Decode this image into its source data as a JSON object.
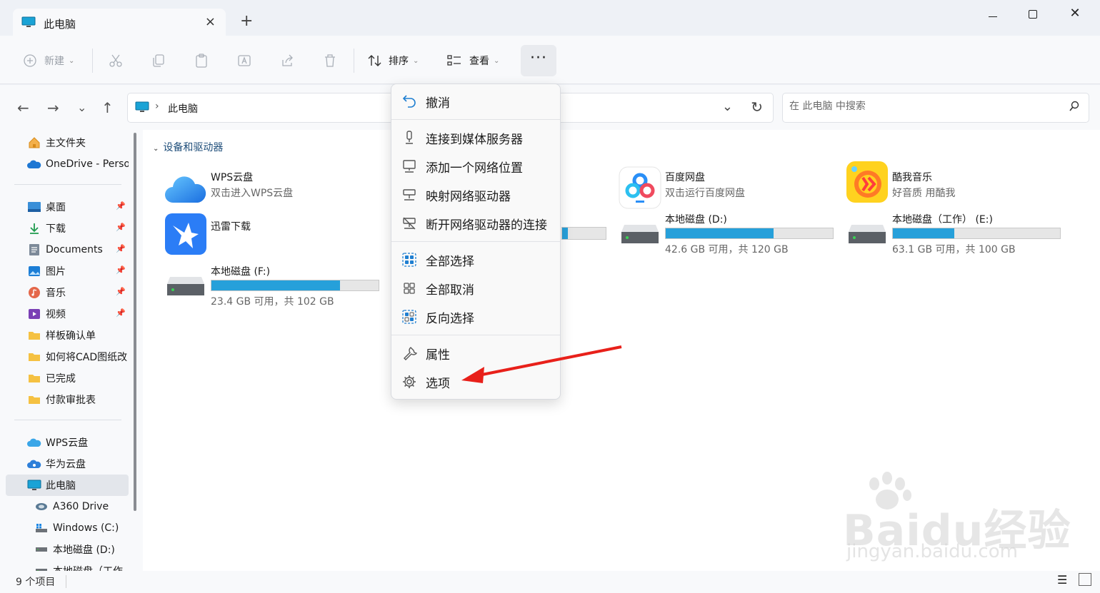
{
  "window": {
    "tab_title": "此电脑",
    "close_tab": "×",
    "new_tab": "+",
    "close": "✕"
  },
  "toolbar": {
    "new": "新建",
    "sort": "排序",
    "view": "查看",
    "more": "···"
  },
  "address": {
    "location": "此电脑",
    "search_placeholder": "在 此电脑 中搜索"
  },
  "sidebar": {
    "home": "主文件夹",
    "onedrive": "OneDrive - Perso",
    "pinned": [
      {
        "label": "桌面",
        "icon": "desktop-icon"
      },
      {
        "label": "下载",
        "icon": "download-icon"
      },
      {
        "label": "Documents",
        "icon": "document-icon"
      },
      {
        "label": "图片",
        "icon": "pictures-icon"
      },
      {
        "label": "音乐",
        "icon": "music-icon"
      },
      {
        "label": "视频",
        "icon": "video-icon"
      },
      {
        "label": "样板确认单",
        "icon": "folder-icon"
      },
      {
        "label": "如何将CAD图纸改",
        "icon": "folder-icon"
      },
      {
        "label": "已完成",
        "icon": "folder-icon"
      },
      {
        "label": "付款审批表",
        "icon": "folder-icon"
      }
    ],
    "wps": "WPS云盘",
    "huawei": "华为云盘",
    "this_pc": "此电脑",
    "drives": [
      "A360 Drive",
      "Windows (C:)",
      "本地磁盘 (D:)",
      "本地磁盘（工作"
    ]
  },
  "content": {
    "group": "设备和驱动器",
    "items": [
      {
        "title": "WPS云盘",
        "subtitle": "双击进入WPS云盘",
        "icon": "wps-cloud-icon"
      },
      {
        "title": "百度网盘",
        "subtitle": "双击运行百度网盘",
        "icon": "baidu-netdisk-icon"
      },
      {
        "title": "酷我音乐",
        "subtitle": "好音质 用酷我",
        "icon": "kuwo-music-icon"
      },
      {
        "title": "迅雷下载",
        "icon": "xunlei-icon"
      }
    ],
    "drives": [
      {
        "title": "本地磁盘 (D:)",
        "info": "42.6 GB 可用，共 120 GB",
        "used": 0.645
      },
      {
        "title": "本地磁盘（工作） (E:)",
        "info": "63.1 GB 可用，共 100 GB",
        "used": 0.369
      },
      {
        "title": "本地磁盘 (F:)",
        "info": "23.4 GB 可用，共 102 GB",
        "used": 0.771
      }
    ]
  },
  "menu": {
    "undo": "撤消",
    "connect_media": "连接到媒体服务器",
    "add_network": "添加一个网络位置",
    "map_drive": "映射网络驱动器",
    "disconnect_drive": "断开网络驱动器的连接",
    "select_all": "全部选择",
    "select_none": "全部取消",
    "invert": "反向选择",
    "properties": "属性",
    "options": "选项"
  },
  "status": {
    "count": "9 个项目"
  },
  "watermark": {
    "logo": "Baidu经验",
    "url": "jingyan.baidu.com"
  },
  "colors": {
    "accent": "#26a0da",
    "arrow": "#e8201a"
  }
}
